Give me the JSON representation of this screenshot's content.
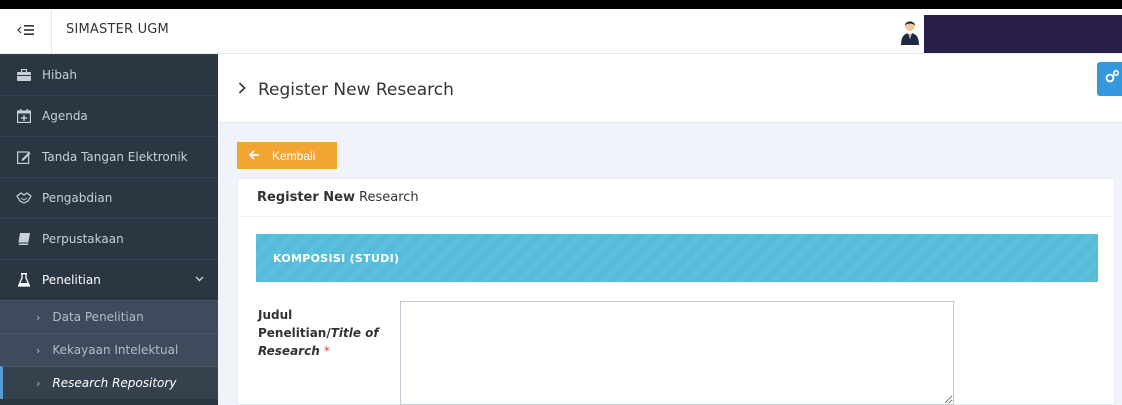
{
  "topbar": {
    "app_title": "SIMASTER UGM",
    "menu_icon": "sidebar-toggle-icon",
    "avatar_icon": "user-avatar-icon"
  },
  "sidebar": {
    "items": [
      {
        "label": "Hibah",
        "icon": "briefcase-icon"
      },
      {
        "label": "Agenda",
        "icon": "calendar-plus-icon"
      },
      {
        "label": "Tanda Tangan Elektronik",
        "icon": "edit-icon"
      },
      {
        "label": "Pengabdian",
        "icon": "handshake-icon"
      },
      {
        "label": "Perpustakaan",
        "icon": "book-icon"
      },
      {
        "label": "Penelitian",
        "icon": "flask-icon"
      }
    ],
    "subitems": [
      {
        "label": "Data Penelitian"
      },
      {
        "label": "Kekayaan Intelektual"
      },
      {
        "label": "Research Repository"
      }
    ]
  },
  "page": {
    "title": "Register New Research",
    "back_label": "Kembali"
  },
  "portlet": {
    "title_bold": "Register New",
    "title_rest": "Research",
    "section_title": "KOMPOSISI (STUDI)",
    "field_label_id": "Judul Penelitian/",
    "field_label_en": "Title of Research",
    "required_mark": "*",
    "field_value": ""
  },
  "colors": {
    "sidebar_bg": "#2b3643",
    "accent_blue": "#3598dc",
    "warning_orange": "#f3a533",
    "info_cyan": "#5bc0de",
    "required_red": "#e73d4a"
  }
}
